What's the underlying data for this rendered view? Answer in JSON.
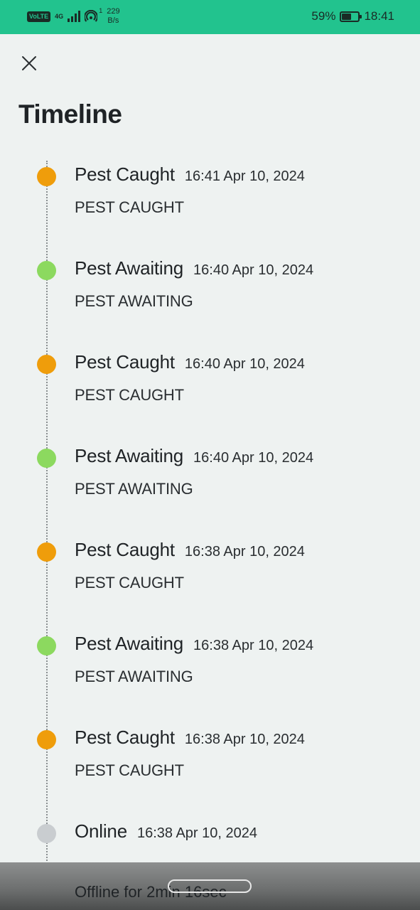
{
  "status_bar": {
    "volte": "VoLTE",
    "network": "4G",
    "hotspot_count": "1",
    "data_speed_value": "229",
    "data_speed_unit": "B/s",
    "battery_percent": "59%",
    "time": "18:41"
  },
  "page": {
    "title": "Timeline"
  },
  "colors": {
    "caught": "#ef9d0b",
    "awaiting": "#8cd95f",
    "online": "#c9cdd0",
    "status_bar": "#22c38e"
  },
  "timeline": [
    {
      "title": "Pest Caught",
      "time": "16:41 Apr 10, 2024",
      "desc": "PEST CAUGHT",
      "status": "caught"
    },
    {
      "title": "Pest Awaiting",
      "time": "16:40 Apr 10, 2024",
      "desc": "PEST AWAITING",
      "status": "awaiting"
    },
    {
      "title": "Pest Caught",
      "time": "16:40 Apr 10, 2024",
      "desc": "PEST CAUGHT",
      "status": "caught"
    },
    {
      "title": "Pest Awaiting",
      "time": "16:40 Apr 10, 2024",
      "desc": "PEST AWAITING",
      "status": "awaiting"
    },
    {
      "title": "Pest Caught",
      "time": "16:38 Apr 10, 2024",
      "desc": "PEST CAUGHT",
      "status": "caught"
    },
    {
      "title": "Pest Awaiting",
      "time": "16:38 Apr 10, 2024",
      "desc": "PEST AWAITING",
      "status": "awaiting"
    },
    {
      "title": "Pest Caught",
      "time": "16:38 Apr 10, 2024",
      "desc": "PEST CAUGHT",
      "status": "caught"
    },
    {
      "title": "Online",
      "time": "16:38 Apr 10, 2024",
      "desc": "Offline for 2min 16sec",
      "status": "online"
    }
  ]
}
